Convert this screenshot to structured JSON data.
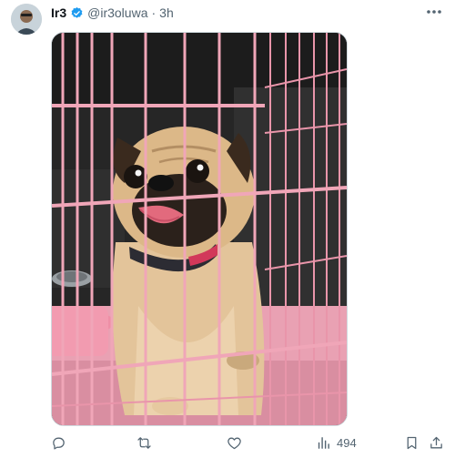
{
  "tweet": {
    "author": {
      "display_name": "Ir3",
      "handle": "@ir3oluwa",
      "separator": "·",
      "time": "3h"
    },
    "actions": {
      "views_count": "494"
    }
  },
  "colors": {
    "verified": "#1d9bf0",
    "icon_gray": "#536471",
    "cage_pink": "#f0a6b8"
  },
  "icons": [
    "verified-badge-icon",
    "more-icon",
    "reply-icon",
    "retweet-icon",
    "like-icon",
    "views-icon",
    "bookmark-icon",
    "share-icon"
  ]
}
